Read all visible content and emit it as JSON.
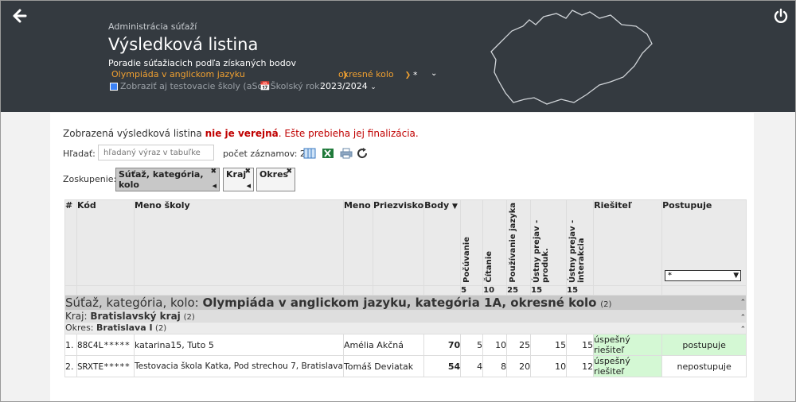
{
  "header": {
    "admin_label": "Administrácia súťaží",
    "title": "Výsledková listina",
    "subtitle": "Poradie súťažiacich podľa získaných bodov",
    "competition": "Olympiáda v anglickom jazyku",
    "round": "okresné kolo",
    "star": "*",
    "test_schools_label": "Zobraziť aj testovacie školy (aSc)",
    "school_year_label": "Školský rok:",
    "school_year": "2023/2024"
  },
  "notice": {
    "prefix": "Zobrazená výsledková listina ",
    "bold": "nie je verejná",
    "suffix": ". Ešte prebieha jej finalizácia."
  },
  "search": {
    "label": "Hľadať:",
    "placeholder": "hľadaný výraz v tabuľke",
    "count": "počet záznamov: 2"
  },
  "grouping": {
    "label": "Zoskupenie:",
    "chips": [
      "Súťaž, kategória, kolo",
      "Kraj",
      "Okres"
    ]
  },
  "table": {
    "headers": {
      "num": "#",
      "code": "Kód",
      "school": "Meno školy",
      "name": "Meno",
      "surname": "Priezvisko",
      "points": "Body",
      "c1": "Počúvanie",
      "c2": "Čítanie",
      "c3": "Používanie jazyka",
      "c4": "Ústny prejav - produk.",
      "c5": "Ústny prejav - interakcia",
      "solver": "Riešiteľ",
      "advance": "Postupuje"
    },
    "sort_glyph": "▼",
    "filter_value": "*",
    "max_points": [
      "5",
      "10",
      "25",
      "15",
      "15"
    ],
    "group1": {
      "label": "Súťaž, kategória, kolo: ",
      "value": "Olympiáda v anglickom jazyku, kategória 1A, okresné kolo",
      "count": "(2)"
    },
    "group2": {
      "label": "Kraj: ",
      "value": "Bratislavský kraj",
      "count": "(2)"
    },
    "group3": {
      "label": "Okres: ",
      "value": "Bratislava I",
      "count": "(2)"
    },
    "rows": [
      {
        "num": "1.",
        "code": "88C4L*****",
        "school": "katarina15, Tuto 5",
        "name": "Amélia Akčná",
        "points": "70",
        "c1": "5",
        "c2": "10",
        "c3": "25",
        "c4": "15",
        "c5": "15",
        "solver": "úspešný riešiteľ",
        "advance": "postupuje"
      },
      {
        "num": "2.",
        "code": "SRXTE*****",
        "school": "Testovacia škola Katka, Pod strechou 7, Bratislava",
        "name": "Tomáš Deviatak",
        "points": "54",
        "c1": "4",
        "c2": "8",
        "c3": "20",
        "c4": "10",
        "c5": "12",
        "solver": "úspešný riešiteľ",
        "advance": "nepostupuje"
      }
    ]
  },
  "icons": {
    "back": "arrow-left-icon",
    "power": "power-icon",
    "columns": "columns-icon",
    "excel": "excel-icon",
    "print": "print-icon",
    "refresh": "refresh-icon"
  },
  "colors": {
    "header_bg": "#343a40",
    "accent_orange": "#f0a030",
    "notice_red": "#c00000",
    "success_green": "#d4f8d4"
  }
}
